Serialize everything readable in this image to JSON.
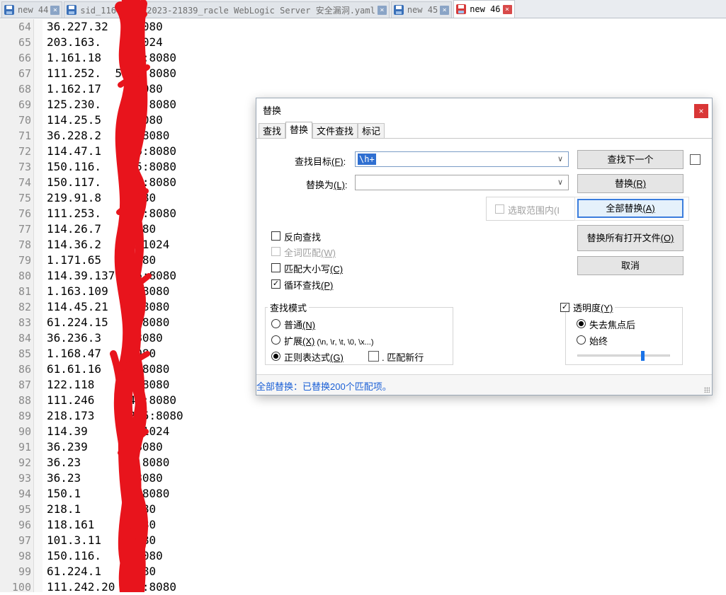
{
  "tabs": [
    {
      "label": "new 44",
      "active": false
    },
    {
      "label": "sid_1164_CVE-2023-21839_racle WebLogic Server 安全漏洞.yaml",
      "active": false
    },
    {
      "label": "new 45",
      "active": false
    },
    {
      "label": "new 46",
      "active": true
    }
  ],
  "tab_close_glyph": "×",
  "lines": [
    {
      "n": "64",
      "text": "36.227.32  2:8080"
    },
    {
      "n": "65",
      "text": "203.163.   2:1024"
    },
    {
      "n": "66",
      "text": "1.161.18   249:8080"
    },
    {
      "n": "67",
      "text": "111.252.  5 23:8080"
    },
    {
      "n": "68",
      "text": "1.162.17   7 8080"
    },
    {
      "n": "69",
      "text": "125.230.   151:8080"
    },
    {
      "n": "70",
      "text": "114.25.5   0:8080"
    },
    {
      "n": "71",
      "text": "36.228.2   05:8080"
    },
    {
      "n": "72",
      "text": "114.47.1    26:8080"
    },
    {
      "n": "73",
      "text": "150.116.   155:8080"
    },
    {
      "n": "74",
      "text": "150.117.   174:8080"
    },
    {
      "n": "75",
      "text": "219.91.8   :8080"
    },
    {
      "n": "76",
      "text": "111.253.    24:8080"
    },
    {
      "n": "77",
      "text": "114.26.7    8080"
    },
    {
      "n": "78",
      "text": "114.36.2    9:1024"
    },
    {
      "n": "79",
      "text": "1.171.65    8080"
    },
    {
      "n": "80",
      "text": "114.39.137  66:8080"
    },
    {
      "n": "81",
      "text": "1.163.109   4:8080"
    },
    {
      "n": "82",
      "text": "114.45.21   3:8080"
    },
    {
      "n": "83",
      "text": "61.224.15   5:8080"
    },
    {
      "n": "84",
      "text": "36.236.3    :8080"
    },
    {
      "n": "85",
      "text": "1.168.47    8080"
    },
    {
      "n": "86",
      "text": "61.61.16    1:8080"
    },
    {
      "n": "87",
      "text": "122.118     9:8080"
    },
    {
      "n": "88",
      "text": "111.246     41:8080"
    },
    {
      "n": "89",
      "text": "218.173     215:8080"
    },
    {
      "n": "90",
      "text": "114.39      5:1024"
    },
    {
      "n": "91",
      "text": "36.239      :8080"
    },
    {
      "n": "92",
      "text": "36.23       4:8080"
    },
    {
      "n": "93",
      "text": "36.23       :8080"
    },
    {
      "n": "94",
      "text": "150.1       4:8080"
    },
    {
      "n": "95",
      "text": "218.1       8080"
    },
    {
      "n": "96",
      "text": "118.161     8080"
    },
    {
      "n": "97",
      "text": "101.3.11    8080"
    },
    {
      "n": "98",
      "text": "150.116.    :8080"
    },
    {
      "n": "99",
      "text": "61.224.1    8080"
    },
    {
      "n": "100",
      "text": "111.242.20   7:8080"
    }
  ],
  "dialog": {
    "title": "替换",
    "close_glyph": "×",
    "tabs": [
      "查找",
      "替换",
      "文件查找",
      "标记"
    ],
    "active_tab": 1,
    "find_label": "查找目标",
    "find_hotkey": "(F)",
    "find_value": "\\h+",
    "replace_label": "替换为",
    "replace_hotkey": "(L)",
    "replace_value": "",
    "colon": ":",
    "in_selection": "选取范围内(I",
    "buttons": {
      "find_next": "查找下一个",
      "replace": "替换",
      "replace_hotkey": "(R)",
      "replace_all": "全部替换",
      "replace_all_hotkey": "(A)",
      "replace_all_open": "替换所有打开文件",
      "replace_all_open_hotkey": "(O)",
      "cancel": "取消"
    },
    "options": {
      "backward": "反向查找",
      "whole_word": "全词匹配",
      "whole_word_hotkey": "(W)",
      "match_case": "匹配大小写",
      "match_case_hotkey": "(C)",
      "wrap": "循环查找",
      "wrap_hotkey": "(P)"
    },
    "search_mode": {
      "title": "查找模式",
      "normal": "普通",
      "normal_hotkey": "(N)",
      "extended": "扩展",
      "extended_hotkey": "(X)",
      "extended_hint": " (\\n, \\r, \\t, \\0, \\x...)",
      "regex": "正则表达式",
      "regex_hotkey": "(G)",
      "newline_dot": ". 匹配新行"
    },
    "transparency": {
      "title": "透明度",
      "title_hotkey": "(Y)",
      "on_lose_focus": "失去焦点后",
      "always": "始终",
      "level": 0.7
    },
    "check_glyph": "✓",
    "arrow_glyph": "∨",
    "status": "全部替换：已替换200个匹配项。"
  },
  "colors": {
    "scribble": "#e8141c",
    "status_text": "#1a5fd6",
    "selection": "#2f6fd1"
  }
}
